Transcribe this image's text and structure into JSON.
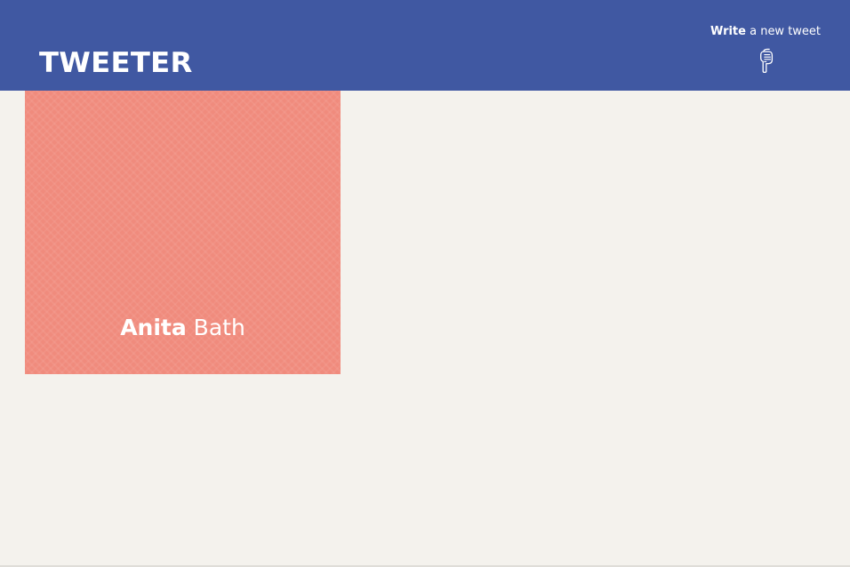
{
  "header": {
    "logo_text": "TWEETER",
    "write_action": {
      "strong_text": "Write",
      "rest_text": " a new tweet",
      "icon": "pointing-hand-down-icon"
    }
  },
  "profile_card": {
    "first_name": "Anita",
    "last_name": " Bath"
  },
  "colors": {
    "header_background": "#4058a2",
    "page_background": "#f4f2ed",
    "card_background": "#f08b7d",
    "text_light": "#ffffff"
  }
}
